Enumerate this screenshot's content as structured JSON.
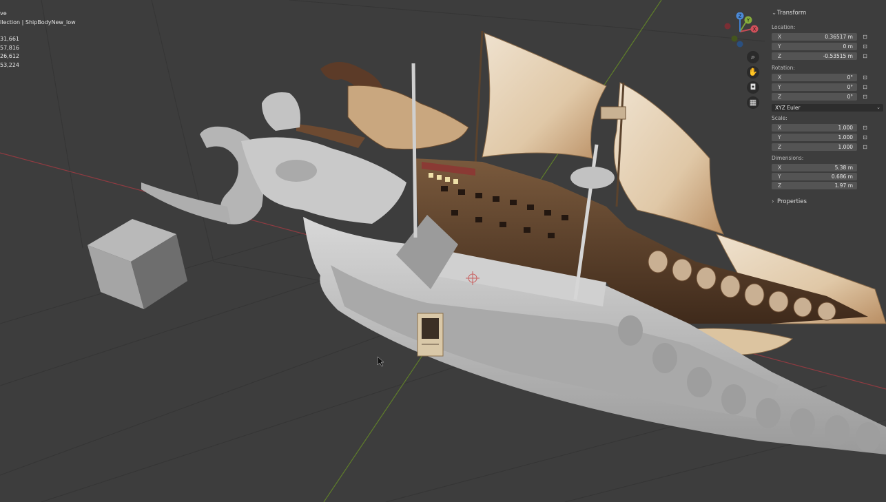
{
  "overlay": {
    "mode_text": "ve",
    "collection_text": "llection | ShipBodyNew_low",
    "stats": [
      "31,661",
      "57,816",
      "26,612",
      "53,224"
    ]
  },
  "npanel": {
    "transform": {
      "title": "Transform",
      "location": {
        "label": "Location:",
        "rows": [
          {
            "axis": "X",
            "value": "0.36517 m"
          },
          {
            "axis": "Y",
            "value": "0 m"
          },
          {
            "axis": "Z",
            "value": "-0.53515 m"
          }
        ]
      },
      "rotation": {
        "label": "Rotation:",
        "rows": [
          {
            "axis": "X",
            "value": "0°"
          },
          {
            "axis": "Y",
            "value": "0°"
          },
          {
            "axis": "Z",
            "value": "0°"
          }
        ]
      },
      "rotation_mode": "XYZ Euler",
      "scale": {
        "label": "Scale:",
        "rows": [
          {
            "axis": "X",
            "value": "1.000"
          },
          {
            "axis": "Y",
            "value": "1.000"
          },
          {
            "axis": "Z",
            "value": "1.000"
          }
        ]
      },
      "dimensions": {
        "label": "Dimensions:",
        "rows": [
          {
            "axis": "X",
            "value": "5.38 m"
          },
          {
            "axis": "Y",
            "value": "0.686 m"
          },
          {
            "axis": "Z",
            "value": "1.97 m"
          }
        ]
      }
    },
    "properties": {
      "title": "Properties"
    }
  },
  "gizmo": {
    "x_label": "X",
    "y_label": "Y",
    "z_label": "Z"
  },
  "colors": {
    "viewport_bg": "#3d3d3d",
    "axis_x": "#b8414a",
    "axis_y": "#6f8c2f",
    "panel_field": "#545454"
  },
  "icons": [
    "zoom-icon",
    "hand-pan-icon",
    "camera-icon",
    "grid-perspective-icon",
    "lock-icon"
  ]
}
